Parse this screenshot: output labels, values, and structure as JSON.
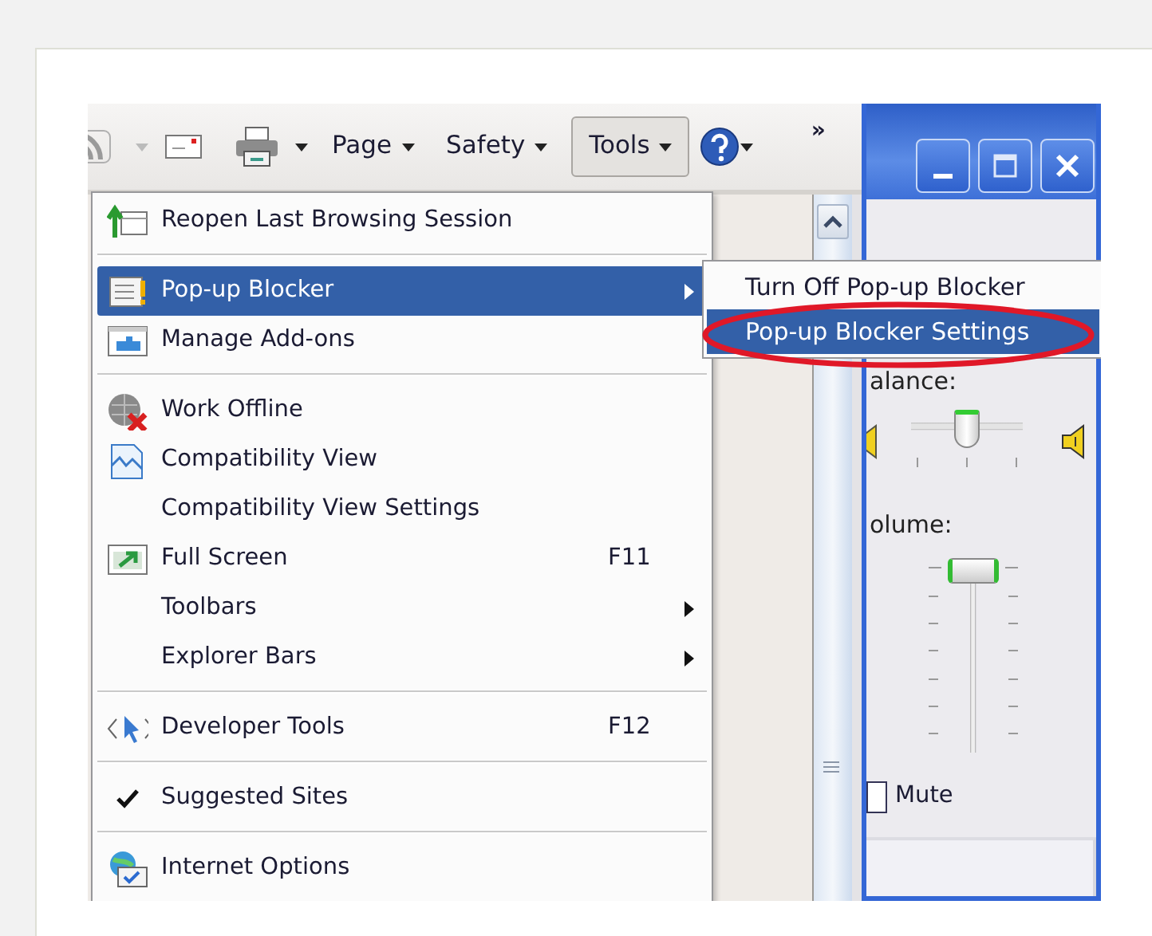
{
  "toolbar": {
    "buttons": [
      {
        "label": "Page",
        "pressed": false
      },
      {
        "label": "Safety",
        "pressed": false
      },
      {
        "label": "Tools",
        "pressed": true
      }
    ],
    "overflow": "»"
  },
  "menu": {
    "items": [
      {
        "kind": "item",
        "label": "Reopen Last Browsing Session",
        "selected": false,
        "checked": false
      },
      {
        "kind": "separator"
      },
      {
        "kind": "item",
        "label": "Pop-up Blocker",
        "submenu": true,
        "selected": true,
        "checked": false
      },
      {
        "kind": "item",
        "label": "Manage Add-ons",
        "selected": false,
        "checked": false
      },
      {
        "kind": "separator"
      },
      {
        "kind": "item",
        "label": "Work Offline",
        "selected": false,
        "checked": false
      },
      {
        "kind": "item",
        "label": "Compatibility View",
        "selected": false,
        "checked": false
      },
      {
        "kind": "item",
        "label": "Compatibility View Settings",
        "selected": false,
        "checked": false
      },
      {
        "kind": "item",
        "label": "Full Screen",
        "shortcut": "F11",
        "selected": false,
        "checked": false
      },
      {
        "kind": "item",
        "label": "Toolbars",
        "submenu": true,
        "selected": false,
        "checked": false
      },
      {
        "kind": "item",
        "label": "Explorer Bars",
        "submenu": true,
        "selected": false,
        "checked": false
      },
      {
        "kind": "separator"
      },
      {
        "kind": "item",
        "label": "Developer Tools",
        "shortcut": "F12",
        "selected": false,
        "checked": false
      },
      {
        "kind": "separator"
      },
      {
        "kind": "item",
        "label": "Suggested Sites",
        "selected": false,
        "checked": true
      },
      {
        "kind": "separator"
      },
      {
        "kind": "item",
        "label": "Internet Options",
        "selected": false,
        "checked": false
      }
    ]
  },
  "submenu": {
    "items": [
      {
        "label": "Turn Off Pop-up Blocker",
        "selected": false,
        "circled": false
      },
      {
        "label": "Pop-up Blocker Settings",
        "selected": true,
        "circled": true
      }
    ]
  },
  "volume_window": {
    "balance_label": "alance:",
    "balance": {
      "level": 0.5
    },
    "volume_label": "olume:",
    "volume": {
      "level": 1
    },
    "mute": {
      "label": "Mute",
      "checked": false
    }
  }
}
